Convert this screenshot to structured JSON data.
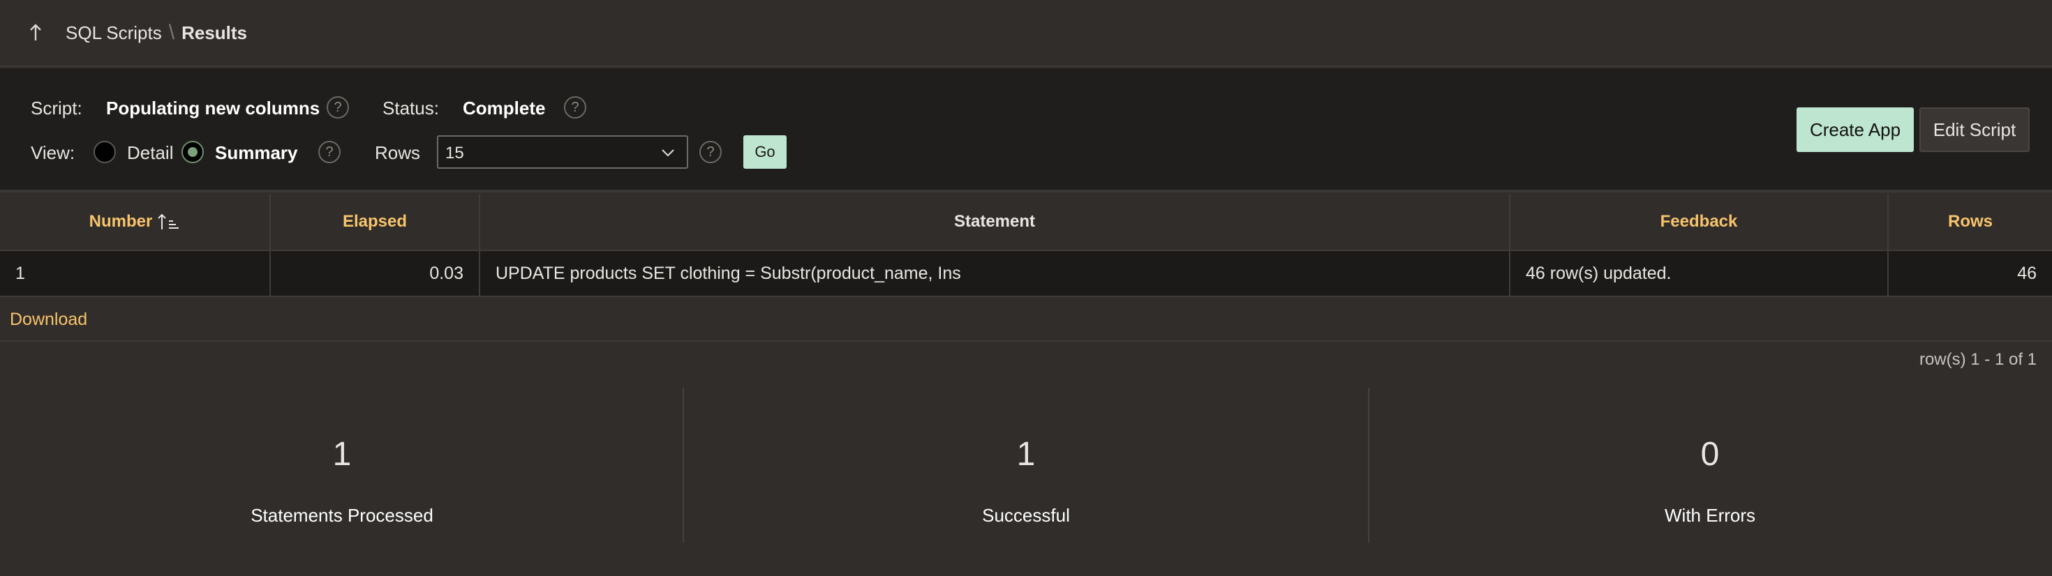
{
  "breadcrumb": {
    "parent": "SQL Scripts",
    "separator": "\\",
    "current": "Results"
  },
  "controls": {
    "script_label": "Script:",
    "script_value": "Populating new columns",
    "status_label": "Status:",
    "status_value": "Complete",
    "view_label": "View:",
    "view_options": [
      "Detail",
      "Summary"
    ],
    "view_selected": "Summary",
    "rows_label": "Rows",
    "rows_value": "15",
    "go_label": "Go",
    "help_glyph": "?"
  },
  "actions": {
    "create_app": "Create App",
    "edit_script": "Edit Script"
  },
  "table": {
    "columns": [
      "Number",
      "Elapsed",
      "Statement",
      "Feedback",
      "Rows"
    ],
    "rows": [
      {
        "number": "1",
        "elapsed": "0.03",
        "statement": "UPDATE products SET clothing = Substr(product_name, Ins",
        "feedback": "46 row(s) updated.",
        "rows": "46"
      }
    ]
  },
  "download_label": "Download",
  "pagination": "row(s) 1 - 1 of 1",
  "summary": [
    {
      "value": "1",
      "label": "Statements Processed"
    },
    {
      "value": "1",
      "label": "Successful"
    },
    {
      "value": "0",
      "label": "With Errors"
    }
  ],
  "colors": {
    "accent_green": "#bde5cf",
    "header_gold": "#f7c46c",
    "background": "#312d2a"
  }
}
